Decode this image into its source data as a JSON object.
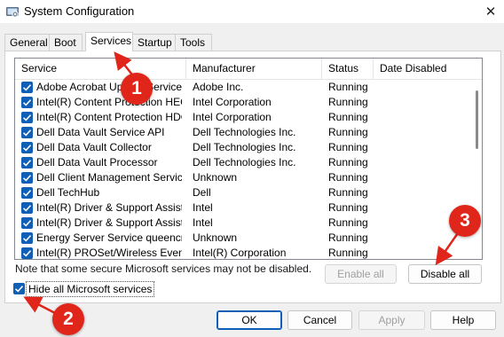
{
  "window": {
    "title": "System Configuration",
    "close_glyph": "✕"
  },
  "tabs": [
    {
      "label": "General",
      "active": false
    },
    {
      "label": "Boot",
      "active": false
    },
    {
      "label": "Services",
      "active": true
    },
    {
      "label": "Startup",
      "active": false
    },
    {
      "label": "Tools",
      "active": false
    }
  ],
  "table": {
    "columns": [
      "Service",
      "Manufacturer",
      "Status",
      "Date Disabled"
    ],
    "rows": [
      {
        "checked": true,
        "service": "Adobe Acrobat Update Service",
        "manufacturer": "Adobe Inc.",
        "status": "Running",
        "date_disabled": ""
      },
      {
        "checked": true,
        "service": "Intel(R) Content Protection HEC...",
        "manufacturer": "Intel Corporation",
        "status": "Running",
        "date_disabled": ""
      },
      {
        "checked": true,
        "service": "Intel(R) Content Protection HDC...",
        "manufacturer": "Intel Corporation",
        "status": "Running",
        "date_disabled": ""
      },
      {
        "checked": true,
        "service": "Dell Data Vault Service API",
        "manufacturer": "Dell Technologies Inc.",
        "status": "Running",
        "date_disabled": ""
      },
      {
        "checked": true,
        "service": "Dell Data Vault Collector",
        "manufacturer": "Dell Technologies Inc.",
        "status": "Running",
        "date_disabled": ""
      },
      {
        "checked": true,
        "service": "Dell Data Vault Processor",
        "manufacturer": "Dell Technologies Inc.",
        "status": "Running",
        "date_disabled": ""
      },
      {
        "checked": true,
        "service": "Dell Client Management Service",
        "manufacturer": "Unknown",
        "status": "Running",
        "date_disabled": ""
      },
      {
        "checked": true,
        "service": "Dell TechHub",
        "manufacturer": "Dell",
        "status": "Running",
        "date_disabled": ""
      },
      {
        "checked": true,
        "service": "Intel(R) Driver & Support Assistant",
        "manufacturer": "Intel",
        "status": "Running",
        "date_disabled": ""
      },
      {
        "checked": true,
        "service": "Intel(R) Driver & Support Assist...",
        "manufacturer": "Intel",
        "status": "Running",
        "date_disabled": ""
      },
      {
        "checked": true,
        "service": "Energy Server Service queencreek",
        "manufacturer": "Unknown",
        "status": "Running",
        "date_disabled": ""
      },
      {
        "checked": true,
        "service": "Intel(R) PROSet/Wireless Event ...",
        "manufacturer": "Intel(R) Corporation",
        "status": "Running",
        "date_disabled": ""
      }
    ]
  },
  "note": "Note that some secure Microsoft services may not be disabled.",
  "buttons": {
    "enable_all": "Enable all",
    "disable_all": "Disable all",
    "ok": "OK",
    "cancel": "Cancel",
    "apply": "Apply",
    "help": "Help"
  },
  "hide_microsoft": {
    "label": "Hide all Microsoft services",
    "checked": true
  },
  "annotations": {
    "badge1": "1",
    "badge2": "2",
    "badge3": "3",
    "color": "#e0251a"
  },
  "colors": {
    "accent": "#0f5fb6"
  }
}
